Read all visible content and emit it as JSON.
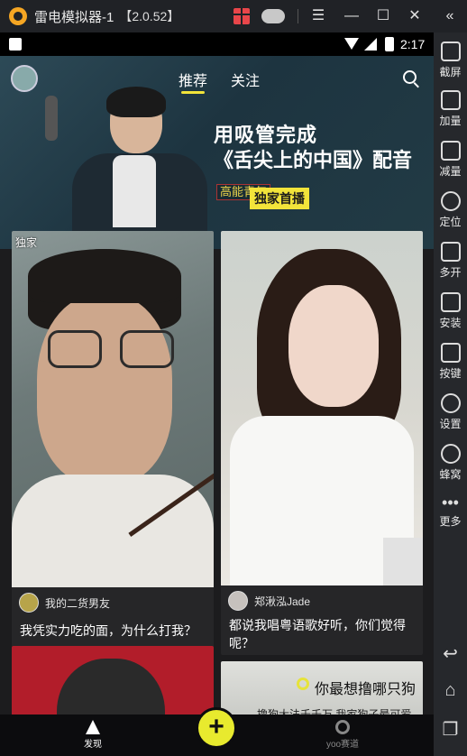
{
  "titlebar": {
    "title": "雷电模拟器-1",
    "version": "【2.0.52】",
    "menu_icon": "☰",
    "min_icon": "—",
    "max_icon": "☐",
    "close_icon": "✕",
    "collapse_icon": "«"
  },
  "statusbar": {
    "time": "2:17"
  },
  "sidebar": {
    "screenshot": "截屏",
    "volume_up": "加量",
    "volume_down": "减量",
    "location": "定位",
    "multi": "多开",
    "install": "安装",
    "keys": "按键",
    "settings": "设置",
    "nest": "蜂窝",
    "more": "更多",
    "back_icon": "↩",
    "home_icon": "⌂",
    "recent_icon": "❐"
  },
  "header": {
    "tabs": [
      "推荐",
      "关注"
    ],
    "active_tab": 0
  },
  "banner": {
    "line1": "用吸管完成",
    "line2": "《舌尖上的中国》配音",
    "tag": "高能青年",
    "exclusive": "独家首播"
  },
  "cards": [
    {
      "badge": "独家",
      "author": "我的二货男友",
      "caption": "我凭实力吃的面，为什么打我？"
    },
    {
      "author": "郑湫泓Jade",
      "caption": "都说我唱粤语歌好听，你们觉得呢？"
    },
    {
      "promo_line1": "你最想撸哪只狗",
      "promo_line2": "撸狗大法千千万 我家狗子最可爱"
    }
  ],
  "bottom_nav": {
    "discover": "发现",
    "add": "+",
    "yoo": "yoo赛道"
  },
  "colors": {
    "accent": "#f2e43a",
    "background": "#1c1c1e"
  }
}
